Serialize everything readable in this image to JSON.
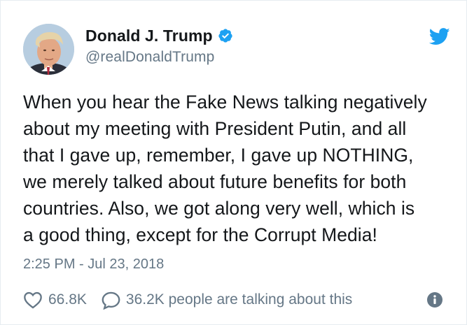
{
  "tweet": {
    "display_name": "Donald J. Trump",
    "handle": "@realDonaldTrump",
    "verified": true,
    "text_lines": [
      "When you hear the Fake News talking negatively",
      "about my meeting with President Putin, and all",
      "that I gave up, remember, I gave up NOTHING,",
      "we merely talked about future benefits for both",
      "countries. Also, we got along very well, which is",
      "a good thing, except for the Corrupt Media!"
    ],
    "timestamp": "2:25 PM - Jul 23, 2018",
    "likes": "66.8K",
    "talking": "36.2K people are talking about this"
  },
  "icons": {
    "brand": "twitter-bird-icon",
    "verified": "verified-badge-icon",
    "like": "heart-icon",
    "reply": "speech-bubble-icon",
    "info": "info-icon"
  },
  "colors": {
    "twitter_blue": "#1da1f2",
    "text_primary": "#14171a",
    "text_secondary": "#657786"
  }
}
